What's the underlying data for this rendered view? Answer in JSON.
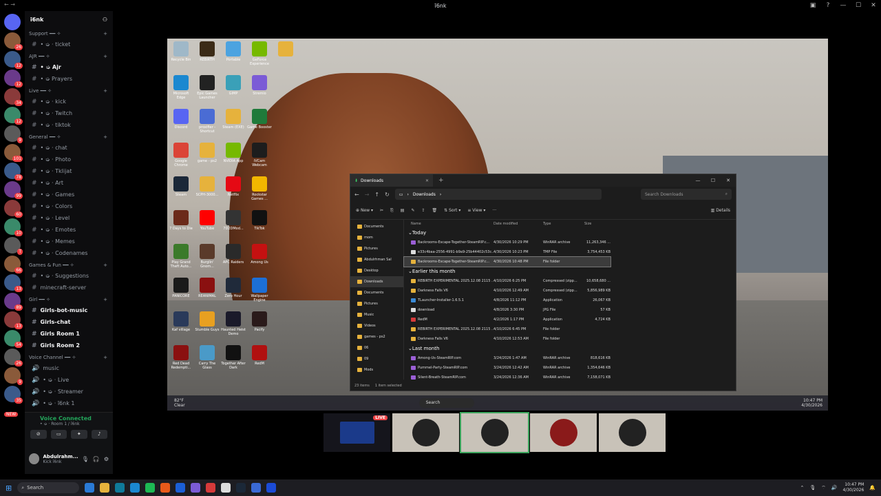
{
  "window": {
    "title": "ī6nk"
  },
  "guild": {
    "name": "ī6nk"
  },
  "categories": [
    {
      "name": "Support ━━ ✧",
      "channels": [
        {
          "label": "• ➭ · ticket"
        }
      ]
    },
    {
      "name": "AJR ━━ ✧",
      "channels": [
        {
          "label": "• ➭ Ajr",
          "bold": true
        },
        {
          "label": "• ➭ Prayers"
        }
      ]
    },
    {
      "name": "Live ━━ ✧",
      "channels": [
        {
          "label": "• ➭ · kick"
        },
        {
          "label": "• ➭ · Twitch"
        },
        {
          "label": "• ➭ · tiktok"
        }
      ]
    },
    {
      "name": "General ━━ ✧",
      "channels": [
        {
          "label": "• ➭ · chat"
        },
        {
          "label": "• ➭ · Photo"
        },
        {
          "label": "• ➭ · Tklijat"
        },
        {
          "label": "• ➭ · Art"
        },
        {
          "label": "• ➭ · Games"
        },
        {
          "label": "• ➭ · Colors"
        },
        {
          "label": "• ➭ · Level"
        },
        {
          "label": "• ➭ · Emotes"
        },
        {
          "label": "• ➭ · Memes"
        },
        {
          "label": "• ➭ · Codenames"
        }
      ]
    },
    {
      "name": "Games & Fun ━━ ✧",
      "channels": [
        {
          "label": "• ➭ · Suggestions"
        },
        {
          "label": "minecraft-server"
        }
      ]
    },
    {
      "name": "Girl ━━ ✧",
      "channels": [
        {
          "label": "Girls-bot-music",
          "bold": true
        },
        {
          "label": "Girls-chat",
          "bold": true
        },
        {
          "label": "Girls Room 1",
          "bold": true
        },
        {
          "label": "Girls Room 2",
          "bold": true
        }
      ]
    },
    {
      "name": "Voice Channel ━━ ✧",
      "channels": [
        {
          "label": "music"
        },
        {
          "label": "• ➭ · Live"
        },
        {
          "label": "• ➭ · Streamer"
        },
        {
          "label": "• ➭ · ī6nk 1"
        }
      ]
    }
  ],
  "server_badges": [
    "26",
    "12",
    "12",
    "34",
    "12",
    "9",
    "101",
    "78",
    "99",
    "60",
    "10",
    "T",
    "66",
    "13",
    "89",
    "13",
    "54",
    "26",
    "9",
    "35"
  ],
  "voice": {
    "status": "Voice Connected",
    "room": "• ➭ · Room 1 / ī6nk",
    "new_badge": "NEW"
  },
  "user": {
    "name": "Abdulrahm...",
    "status": "Kick ī6nk"
  },
  "desktop_icons": [
    {
      "label": "Recycle Bin",
      "color": "#9fb8c8"
    },
    {
      "label": "REBIRTH",
      "color": "#3b2b17"
    },
    {
      "label": "Portable",
      "color": "#4ca3e0"
    },
    {
      "label": "GeForce Experience",
      "color": "#76b900"
    },
    {
      "label": "",
      "color": "#e6b23c"
    },
    {
      "label": "Microsoft Edge",
      "color": "#1b88d0"
    },
    {
      "label": "Epic Games Launcher",
      "color": "#222"
    },
    {
      "label": "GIMP",
      "color": "#3aa0b8"
    },
    {
      "label": "Stremio",
      "color": "#7b5bd6"
    },
    {
      "label": "Discord",
      "color": "#5865f2"
    },
    {
      "label": "proxifier - Shortcut",
      "color": "#4a6cd4"
    },
    {
      "label": "Steam (EXE)",
      "color": "#e6b23c"
    },
    {
      "label": "Game Booster",
      "color": "#1f7a3a"
    },
    {
      "label": "Google Chrome",
      "color": "#db4437"
    },
    {
      "label": "game - ps2",
      "color": "#e6b23c"
    },
    {
      "label": "NVIDIA App",
      "color": "#76b900"
    },
    {
      "label": "iVCam Webcam",
      "color": "#1d1d1d"
    },
    {
      "label": "Steam",
      "color": "#1b2838"
    },
    {
      "label": "SCPH-3000...",
      "color": "#e6b23c"
    },
    {
      "label": "Netflix",
      "color": "#e50914"
    },
    {
      "label": "Rockstar Games ...",
      "color": "#f2b600"
    },
    {
      "label": "7 Days to Die",
      "color": "#6b2a1a"
    },
    {
      "label": "YouTube",
      "color": "#ff0000"
    },
    {
      "label": "7D2DMod...",
      "color": "#333"
    },
    {
      "label": "TikTok",
      "color": "#111"
    },
    {
      "label": "Play Grand Theft Auto...",
      "color": "#3b7a2a"
    },
    {
      "label": "Burglin' Gnom...",
      "color": "#5a3a2a"
    },
    {
      "label": "APC Raiders",
      "color": "#2a2a2a"
    },
    {
      "label": "Among Us",
      "color": "#c51111"
    },
    {
      "label": "PANICORE",
      "color": "#1a1a1a"
    },
    {
      "label": "REANIMAL",
      "color": "#8a1010"
    },
    {
      "label": "Zero Hour",
      "color": "#202a3a"
    },
    {
      "label": "Wallpaper Engine",
      "color": "#1d6fd6"
    },
    {
      "label": "Kaf village",
      "color": "#2a3a5a"
    },
    {
      "label": "Stumble Guys",
      "color": "#e8a020"
    },
    {
      "label": "Haunted Heist Demo",
      "color": "#1a1a2a"
    },
    {
      "label": "Pacify",
      "color": "#2a1a1a"
    },
    {
      "label": "Red Dead Redempti...",
      "color": "#8a1010"
    },
    {
      "label": "Carry The Glass",
      "color": "#4a9ac8"
    },
    {
      "label": "Together After Dark",
      "color": "#111"
    },
    {
      "label": "RedM",
      "color": "#b01010"
    }
  ],
  "explorer": {
    "tab": "Downloads",
    "path": "Downloads",
    "search_placeholder": "Search Downloads",
    "toolbar": {
      "new": "New",
      "sort": "Sort",
      "view": "View",
      "more": "···",
      "details": "Details"
    },
    "nav": [
      {
        "label": "Documents"
      },
      {
        "label": "mom"
      },
      {
        "label": "Pictures"
      },
      {
        "label": "Abdulrhman Sal"
      },
      {
        "label": "Desktop"
      },
      {
        "label": "Downloads",
        "sel": true
      },
      {
        "label": "Documents"
      },
      {
        "label": "Pictures"
      },
      {
        "label": "Music"
      },
      {
        "label": "Videos"
      },
      {
        "label": "games - ps2"
      },
      {
        "label": "06"
      },
      {
        "label": "09"
      },
      {
        "label": "Mods"
      }
    ],
    "columns": {
      "name": "Name",
      "date": "Date modified",
      "type": "Type",
      "size": "Size"
    },
    "groups": [
      {
        "label": "Today",
        "rows": [
          {
            "name": "Backrooms-Escape-Together-SteamRIP.c...",
            "date": "4/30/2026 10:29 PM",
            "type": "WinRAR archive",
            "size": "11,263,346 ...",
            "icon": "#9b5fd6"
          },
          {
            "name": "e33c4baa-2556-4991-b9a9-25b44402c53c...",
            "date": "4/30/2026 10:23 PM",
            "type": "TMP File",
            "size": "3,754,453 KB",
            "icon": "#ddd"
          },
          {
            "name": "Backrooms-Escape-Together-SteamRIP.c...",
            "date": "4/30/2026 10:48 PM",
            "type": "File folder",
            "size": "",
            "icon": "#e6b23c",
            "sel": true
          }
        ]
      },
      {
        "label": "Earlier this month",
        "rows": [
          {
            "name": "REBIRTH EXPERIMENTAL 2025.12.08 2115 ...",
            "date": "4/10/2026 6:25 PM",
            "type": "Compressed (zipp...",
            "size": "10,658,680 ...",
            "icon": "#e6b23c"
          },
          {
            "name": "Darkness Falls V6",
            "date": "4/10/2026 12:49 AM",
            "type": "Compressed (zipp...",
            "size": "5,856,989 KB",
            "icon": "#e6b23c"
          },
          {
            "name": "TLauncher-Installer-1.6.5.1",
            "date": "4/8/2026 11:12 PM",
            "type": "Application",
            "size": "26,067 KB",
            "icon": "#3a8ad6"
          },
          {
            "name": "download",
            "date": "4/8/2026 3:30 PM",
            "type": "JPG File",
            "size": "57 KB",
            "icon": "#ddd"
          },
          {
            "name": "RedM",
            "date": "4/2/2026 1:17 PM",
            "type": "Application",
            "size": "4,724 KB",
            "icon": "#d63a3a"
          },
          {
            "name": "REBIRTH EXPERIMENTAL 2025.12.08 2115 ...",
            "date": "4/10/2026 6:45 PM",
            "type": "File folder",
            "size": "",
            "icon": "#e6b23c"
          },
          {
            "name": "Darkness Falls V6",
            "date": "4/10/2026 12:53 AM",
            "type": "File folder",
            "size": "",
            "icon": "#e6b23c"
          }
        ]
      },
      {
        "label": "Last month",
        "rows": [
          {
            "name": "Among-Us-SteamRIP.com",
            "date": "3/24/2026 1:47 AM",
            "type": "WinRAR archive",
            "size": "818,616 KB",
            "icon": "#9b5fd6"
          },
          {
            "name": "Pummel-Party-SteamRIP.com",
            "date": "3/24/2026 12:42 AM",
            "type": "WinRAR archive",
            "size": "1,354,646 KB",
            "icon": "#9b5fd6"
          },
          {
            "name": "Silent-Breath-SteamRIP.com",
            "date": "3/24/2026 12:36 AM",
            "type": "WinRAR archive",
            "size": "7,158,071 KB",
            "icon": "#9b5fd6"
          }
        ]
      }
    ],
    "status_count": "23 items",
    "status_selected": "1 item selected"
  },
  "stream_taskbar": {
    "search": "Search",
    "weather_temp": "82°F",
    "weather_desc": "Clear",
    "time": "10:47 PM",
    "date": "4/30/2026"
  },
  "tiles": [
    {
      "live": "LIVE"
    },
    {},
    {
      "sel": true
    },
    {},
    {}
  ],
  "taskbar": {
    "search": "Search",
    "time": "10:47 PM",
    "date": "4/30/2026"
  },
  "taskbar_apps": [
    "#2a7ad6",
    "#e6b23c",
    "#0f7a9a",
    "#1b88d0",
    "#1db954",
    "#e85a1a",
    "#1b5fd6",
    "#7b5bd6",
    "#d63a3a",
    "#ddd",
    "#1b2838",
    "#3a6ad6",
    "#1b4bd6"
  ],
  "colors": {
    "voice_green": "#23a55a",
    "live_red": "#ed4245",
    "selection": "#3ba55c"
  }
}
